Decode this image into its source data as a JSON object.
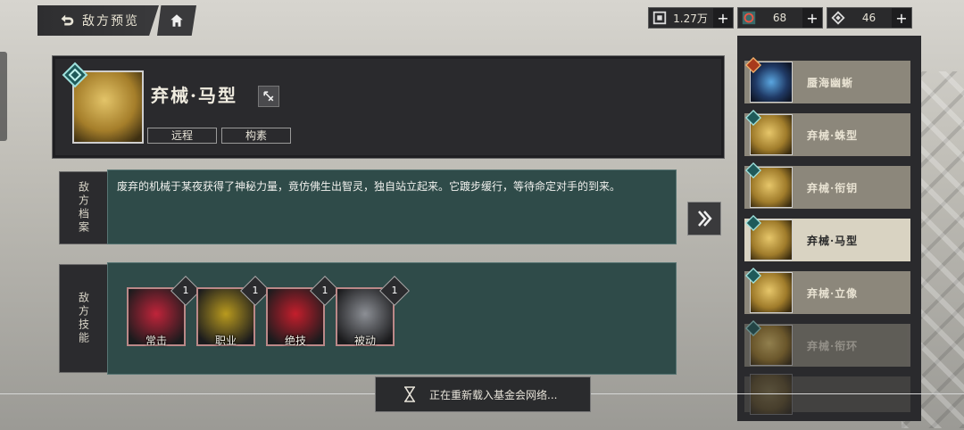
{
  "topbar": {
    "back_title": "敌方预览",
    "resources": [
      {
        "icon": "currency-icon",
        "value": "1.27万"
      },
      {
        "icon": "energy-icon",
        "value": "68"
      },
      {
        "icon": "gem-icon",
        "value": "46"
      }
    ],
    "plus_label": "+"
  },
  "enemy": {
    "name": "弃械·马型",
    "tags": [
      "远程",
      "构素"
    ],
    "type_icon": "bow-icon"
  },
  "sections": {
    "profile_label": "敌方档案",
    "skills_label": "敌方技能"
  },
  "description": "废弃的机械于某夜获得了神秘力量，竟仿佛生出智灵，独自站立起来。它踱步缓行，等待命定对手的到来。",
  "skills": [
    {
      "label": "常击",
      "level": "1",
      "color": "#c0243a"
    },
    {
      "label": "职业",
      "level": "1",
      "color": "#b99a1e"
    },
    {
      "label": "绝技",
      "level": "1",
      "color": "#c41e2c"
    },
    {
      "label": "被动",
      "level": "1",
      "color": "#8c8f95"
    }
  ],
  "enemy_list": [
    {
      "name": "蜃海幽蜥",
      "selected": false,
      "dim": false,
      "badge": "boss-badge"
    },
    {
      "name": "弃械·蛛型",
      "selected": false,
      "dim": false,
      "badge": "elite-badge"
    },
    {
      "name": "弃械·衔钥",
      "selected": false,
      "dim": false,
      "badge": "elite-badge"
    },
    {
      "name": "弃械·马型",
      "selected": true,
      "dim": false,
      "badge": "elite-badge"
    },
    {
      "name": "弃械·立像",
      "selected": false,
      "dim": false,
      "badge": "elite-badge"
    },
    {
      "name": "弃械·衔环",
      "selected": false,
      "dim": true,
      "badge": "elite-badge"
    }
  ],
  "toast": {
    "text": "正在重新载入基金会网络..."
  },
  "colors": {
    "accent_teal": "#2f4b49",
    "panel_dark": "#2a2a2d",
    "list_item": "#8c877b",
    "list_selected": "#d9d3c2"
  }
}
